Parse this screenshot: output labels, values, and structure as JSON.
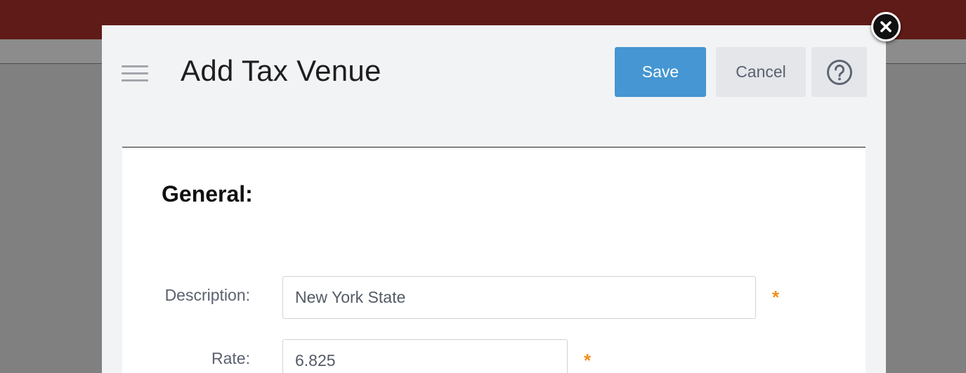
{
  "modal": {
    "title": "Add Tax Venue",
    "save_label": "Save",
    "cancel_label": "Cancel",
    "help_icon": "question-circle-icon",
    "menu_icon": "hamburger-menu-icon",
    "close_icon": "close-circle-icon"
  },
  "form": {
    "section_heading": "General:",
    "fields": [
      {
        "label": "Description:",
        "value": "New York State",
        "required_mark": "*"
      },
      {
        "label": "Rate:",
        "value": "6.825",
        "required_mark": "*"
      }
    ]
  },
  "colors": {
    "topbar": "#5f1b17",
    "overlay": "#808080",
    "primary": "#4596d2",
    "secondary_button": "#e4e6ea",
    "required": "#f0901e",
    "modal_bg": "#f2f3f5"
  }
}
